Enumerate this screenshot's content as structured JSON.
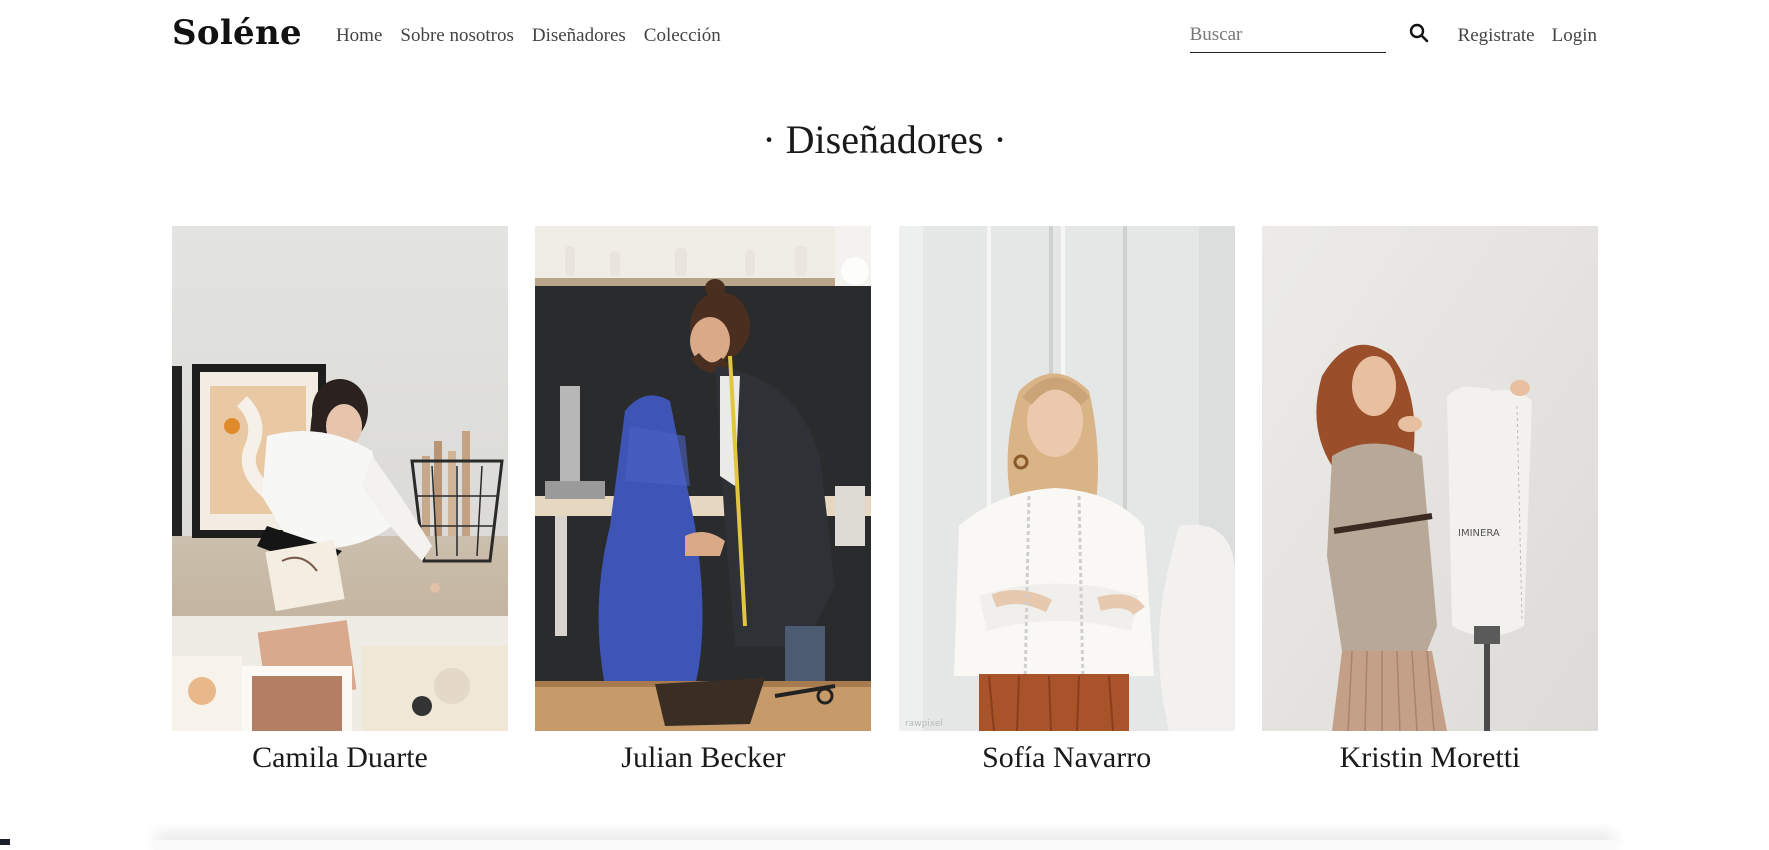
{
  "brand": "Soléne",
  "nav": {
    "links": [
      "Home",
      "Sobre nosotros",
      "Diseñadores",
      "Colección"
    ]
  },
  "search": {
    "placeholder": "Buscar",
    "icon": "search-icon"
  },
  "auth": {
    "register": "Registrate",
    "login": "Login"
  },
  "section": {
    "title": "· Diseñadores ·"
  },
  "designers": [
    {
      "name": "Camila Duarte"
    },
    {
      "name": "Julian Becker"
    },
    {
      "name": "Sofía Navarro"
    },
    {
      "name": "Kristin Moretti"
    }
  ],
  "watermarks": {
    "mannequin_brand": "IMINERA",
    "photo_credit": "rawpixel"
  }
}
